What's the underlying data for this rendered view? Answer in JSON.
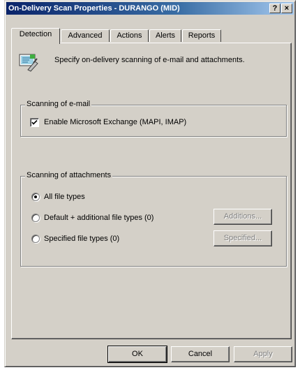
{
  "window": {
    "title": "On-Delivery Scan Properties - DURANGO (MID)",
    "help_glyph": "?",
    "close_glyph": "×"
  },
  "tabs": [
    {
      "label": "Detection",
      "active": true
    },
    {
      "label": "Advanced",
      "active": false
    },
    {
      "label": "Actions",
      "active": false
    },
    {
      "label": "Alerts",
      "active": false
    },
    {
      "label": "Reports",
      "active": false
    }
  ],
  "intro": {
    "icon": "scan-settings-icon",
    "text": "Specify on-delivery scanning of e-mail and attachments."
  },
  "email_group": {
    "title": "Scanning of e-mail",
    "checkbox_label": "Enable Microsoft Exchange (MAPI, IMAP)",
    "checked": true
  },
  "attachments_group": {
    "title": "Scanning of attachments",
    "options": [
      {
        "label": "All file types",
        "selected": true
      },
      {
        "label": "Default + additional file types (0)",
        "selected": false
      },
      {
        "label": "Specified file types (0)",
        "selected": false
      }
    ],
    "additions_button": "Additions...",
    "specified_button": "Specified..."
  },
  "footer": {
    "ok": "OK",
    "cancel": "Cancel",
    "apply": "Apply"
  },
  "colors": {
    "title_start": "#0a246a",
    "title_end": "#a6caf0",
    "face": "#d4d0c8"
  }
}
